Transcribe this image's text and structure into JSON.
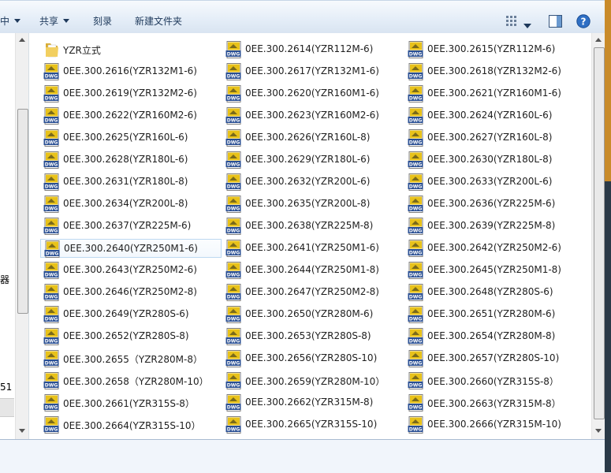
{
  "toolbar": {
    "cut_label": "中",
    "share_label": "共享",
    "burn_label": "刻录",
    "new_folder_label": "新建文件夹",
    "view_icon": "view-tiles-icon",
    "pane_icon": "preview-pane-icon",
    "help_icon": "help-icon"
  },
  "nav": {
    "text_1": "器",
    "text_2": "51"
  },
  "files": [
    {
      "name": "YZR立式",
      "type": "folder"
    },
    {
      "name": "0EE.300.2614(YZR112M-6)",
      "type": "dwg"
    },
    {
      "name": "0EE.300.2615(YZR112M-6)",
      "type": "dwg"
    },
    {
      "name": "0EE.300.2616(YZR132M1-6)",
      "type": "dwg"
    },
    {
      "name": "0EE.300.2617(YZR132M1-6)",
      "type": "dwg"
    },
    {
      "name": "0EE.300.2618(YZR132M2-6)",
      "type": "dwg"
    },
    {
      "name": "0EE.300.2619(YZR132M2-6)",
      "type": "dwg"
    },
    {
      "name": "0EE.300.2620(YZR160M1-6)",
      "type": "dwg"
    },
    {
      "name": "0EE.300.2621(YZR160M1-6)",
      "type": "dwg"
    },
    {
      "name": "0EE.300.2622(YZR160M2-6)",
      "type": "dwg"
    },
    {
      "name": "0EE.300.2623(YZR160M2-6)",
      "type": "dwg"
    },
    {
      "name": "0EE.300.2624(YZR160L-6)",
      "type": "dwg"
    },
    {
      "name": "0EE.300.2625(YZR160L-6)",
      "type": "dwg"
    },
    {
      "name": "0EE.300.2626(YZR160L-8)",
      "type": "dwg"
    },
    {
      "name": "0EE.300.2627(YZR160L-8)",
      "type": "dwg"
    },
    {
      "name": "0EE.300.2628(YZR180L-6)",
      "type": "dwg"
    },
    {
      "name": "0EE.300.2629(YZR180L-6)",
      "type": "dwg"
    },
    {
      "name": "0EE.300.2630(YZR180L-8)",
      "type": "dwg"
    },
    {
      "name": "0EE.300.2631(YZR180L-8)",
      "type": "dwg"
    },
    {
      "name": "0EE.300.2632(YZR200L-6)",
      "type": "dwg"
    },
    {
      "name": "0EE.300.2633(YZR200L-6)",
      "type": "dwg"
    },
    {
      "name": "0EE.300.2634(YZR200L-8)",
      "type": "dwg"
    },
    {
      "name": "0EE.300.2635(YZR200L-8)",
      "type": "dwg"
    },
    {
      "name": "0EE.300.2636(YZR225M-6)",
      "type": "dwg"
    },
    {
      "name": "0EE.300.2637(YZR225M-6)",
      "type": "dwg"
    },
    {
      "name": "0EE.300.2638(YZR225M-8)",
      "type": "dwg"
    },
    {
      "name": "0EE.300.2639(YZR225M-8)",
      "type": "dwg"
    },
    {
      "name": "0EE.300.2640(YZR250M1-6)",
      "type": "dwg",
      "selected": true
    },
    {
      "name": "0EE.300.2641(YZR250M1-6)",
      "type": "dwg"
    },
    {
      "name": "0EE.300.2642(YZR250M2-6)",
      "type": "dwg"
    },
    {
      "name": "0EE.300.2643(YZR250M2-6)",
      "type": "dwg"
    },
    {
      "name": "0EE.300.2644(YZR250M1-8)",
      "type": "dwg"
    },
    {
      "name": "0EE.300.2645(YZR250M1-8)",
      "type": "dwg"
    },
    {
      "name": "0EE.300.2646(YZR250M2-8)",
      "type": "dwg"
    },
    {
      "name": "0EE.300.2647(YZR250M2-8)",
      "type": "dwg"
    },
    {
      "name": "0EE.300.2648(YZR280S-6)",
      "type": "dwg"
    },
    {
      "name": "0EE.300.2649(YZR280S-6)",
      "type": "dwg"
    },
    {
      "name": "0EE.300.2650(YZR280M-6)",
      "type": "dwg"
    },
    {
      "name": "0EE.300.2651(YZR280M-6)",
      "type": "dwg"
    },
    {
      "name": "0EE.300.2652(YZR280S-8)",
      "type": "dwg"
    },
    {
      "name": "0EE.300.2653(YZR280S-8)",
      "type": "dwg"
    },
    {
      "name": "0EE.300.2654(YZR280M-8)",
      "type": "dwg"
    },
    {
      "name": "0EE.300.2655（YZR280M-8）",
      "type": "dwg"
    },
    {
      "name": "0EE.300.2656(YZR280S-10)",
      "type": "dwg"
    },
    {
      "name": "0EE.300.2657(YZR280S-10)",
      "type": "dwg"
    },
    {
      "name": "0EE.300.2658（YZR280M-10）",
      "type": "dwg"
    },
    {
      "name": "0EE.300.2659(YZR280M-10）",
      "type": "dwg"
    },
    {
      "name": "0EE.300.2660(YZR315S-8）",
      "type": "dwg"
    },
    {
      "name": "0EE.300.2661(YZR315S-8）",
      "type": "dwg"
    },
    {
      "name": "0EE.300.2662(YZR315M-8)",
      "type": "dwg"
    },
    {
      "name": "0EE.300.2663(YZR315M-8）",
      "type": "dwg"
    },
    {
      "name": "0EE.300.2664(YZR315S-10）",
      "type": "dwg"
    },
    {
      "name": "0EE.300.2665(YZR315S-10)",
      "type": "dwg"
    },
    {
      "name": "0EE.300.2666(YZR315M-10)",
      "type": "dwg"
    }
  ],
  "colors": {
    "dwg_yellow": "#e8c21a",
    "dwg_blue": "#2a4f93",
    "folder_yellow": "#f2cf60",
    "toolbar_text": "#1e395b",
    "selection_border": "#bcd8f1"
  }
}
